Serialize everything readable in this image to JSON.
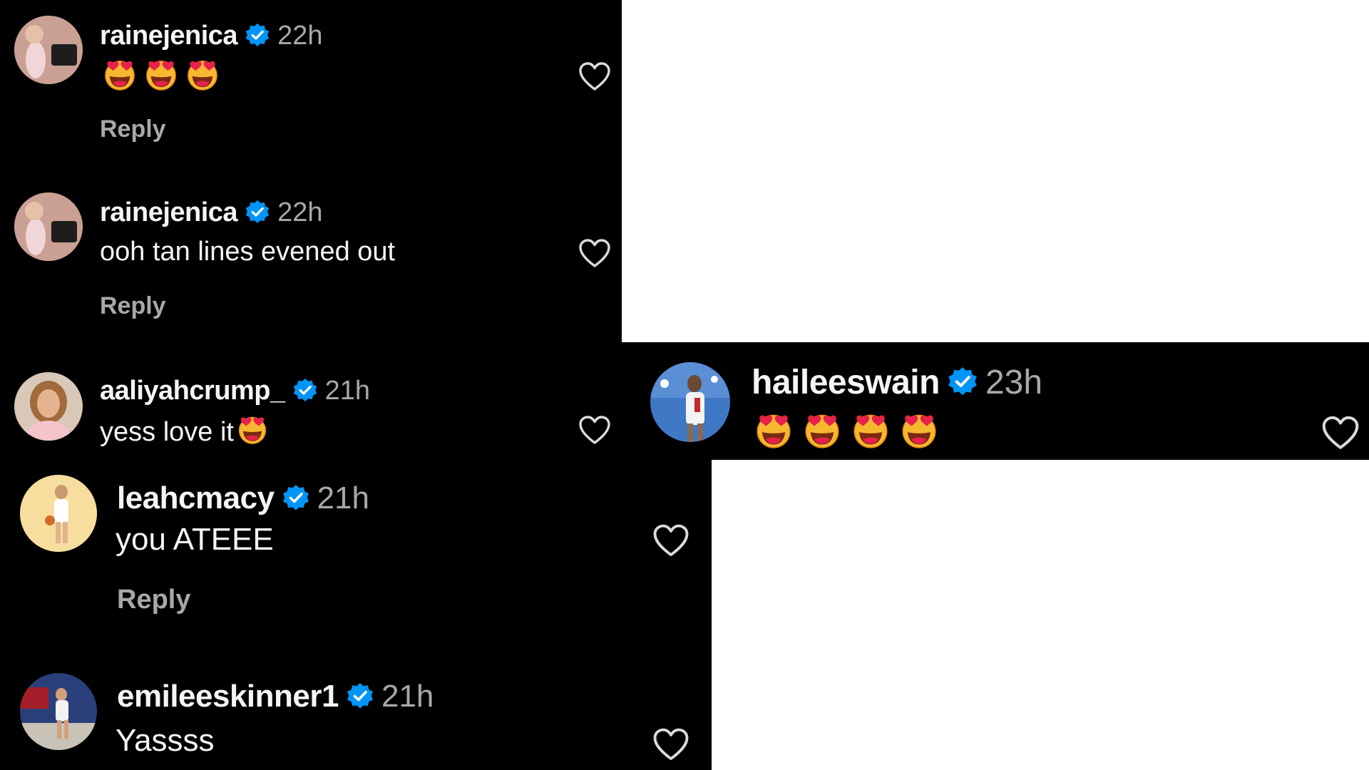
{
  "colors": {
    "panel_bg": "#000000",
    "username": "#f5f5f5",
    "time": "#a8a8a8",
    "reply": "#a8a8a8",
    "verified": "#0095f6",
    "heart_outline": "#dbdbdb"
  },
  "comments": [
    {
      "username": "rainejenica",
      "verified": true,
      "time": "22h",
      "text": "",
      "emoji": [
        "heart-eyes",
        "heart-eyes",
        "heart-eyes"
      ],
      "reply_label": "Reply",
      "avatar": "avatar-rainejenica"
    },
    {
      "username": "rainejenica",
      "verified": true,
      "time": "22h",
      "text": "ooh tan lines evened out",
      "reply_label": "Reply",
      "avatar": "avatar-rainejenica"
    },
    {
      "username": "aaliyahcrump_",
      "verified": true,
      "time": "21h",
      "text": "yess love it",
      "emoji": [
        "heart-eyes"
      ],
      "avatar": "avatar-aaliyahcrump"
    },
    {
      "username": "leahcmacy",
      "verified": true,
      "time": "21h",
      "text": "you ATEEE",
      "reply_label": "Reply",
      "avatar": "avatar-leahcmacy"
    },
    {
      "username": "emileeskinner1",
      "verified": true,
      "time": "21h",
      "text": "Yassss",
      "avatar": "avatar-emileeskinner1"
    },
    {
      "username": "haileeswain",
      "verified": true,
      "time": "23h",
      "text": "",
      "emoji": [
        "heart-eyes",
        "heart-eyes",
        "heart-eyes",
        "heart-eyes"
      ],
      "avatar": "avatar-haileeswain"
    }
  ],
  "icons": {
    "verified": "verified-badge-icon",
    "like": "heart-outline-icon",
    "emoji": "smiling-face-with-heart-eyes-emoji"
  }
}
